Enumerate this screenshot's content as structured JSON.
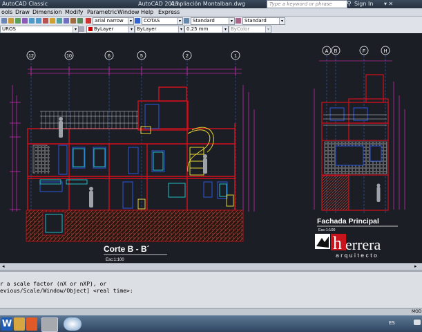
{
  "titlebar": {
    "workspace": "AutoCAD Classic",
    "app_name": "AutoCAD 2013",
    "document": "Ampliación Montalban.dwg",
    "search_placeholder": "Type a keyword or phrase",
    "sign_in": "Sign In"
  },
  "menu": [
    "ools",
    "Draw",
    "Dimension",
    "Modify",
    "Parametric",
    "Window",
    "Help",
    "Express"
  ],
  "toolbar1": {
    "text_style": "arial narrow",
    "dim_style": "COTAS",
    "table_style": "Standard",
    "multileader_style": "Standard"
  },
  "toolbar2": {
    "layer": "UROS",
    "color": "ByLayer",
    "linetype": "ByLayer",
    "lineweight": "0.25 mm",
    "plot_style": "ByColor"
  },
  "drawing": {
    "section_title": "Corte B - B´",
    "section_scale": "Esc:1:100",
    "facade_title": "Fachada Principal",
    "facade_scale": "Esc:1:100",
    "axis_labels_section": [
      "12",
      "10",
      "6",
      "5",
      "2",
      "1"
    ],
    "axis_labels_facade": [
      "A",
      "B",
      "F",
      "H"
    ],
    "logo_letter": "h",
    "logo_word": "errera",
    "logo_sub": "arquitecto"
  },
  "command": {
    "line1": "r a scale factor (nX or nXP), or",
    "line2": "evious/Scale/Window/Object] <real time>:"
  },
  "statusbar": {
    "model_label": "MOD"
  },
  "taskbar": {
    "language": "ES"
  },
  "colors": {
    "canvas_bg": "#1b1f25",
    "wall_red": "#d40f1c",
    "dim_magenta": "#ff2bd5",
    "furniture_cyan": "#28e4ee",
    "stairs_yellow": "#e7d534",
    "grid_blue": "#3a6fd8",
    "text_white": "#ffffff"
  }
}
